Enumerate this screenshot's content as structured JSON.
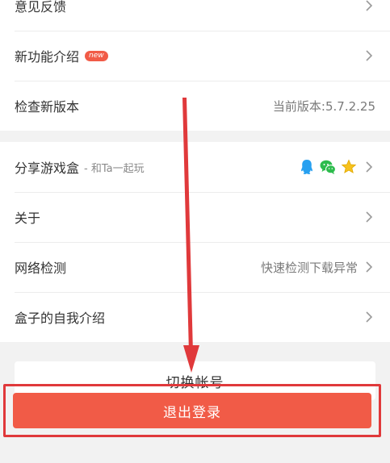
{
  "settings": {
    "feedback_label": "意见反馈",
    "new_features": {
      "label": "新功能介绍",
      "badge": "new"
    },
    "check_update": {
      "label": "检查新版本",
      "value": "当前版本:5.7.2.25"
    },
    "share": {
      "label": "分享游戏盒",
      "subtitle": "- 和Ta一起玩",
      "icons": [
        "qq-icon",
        "wechat-icon",
        "star-icon"
      ]
    },
    "about": {
      "label": "关于"
    },
    "network": {
      "label": "网络检测",
      "value": "快速检测下载异常"
    },
    "intro": {
      "label": "盒子的自我介绍"
    }
  },
  "actions": {
    "switch_account": "切换帐号",
    "logout": "退出登录"
  },
  "colors": {
    "accent": "#f15b47",
    "highlight": "#e0393b",
    "qq": "#27a0f0",
    "wechat": "#2dbc4d",
    "star": "#f7c21e"
  }
}
